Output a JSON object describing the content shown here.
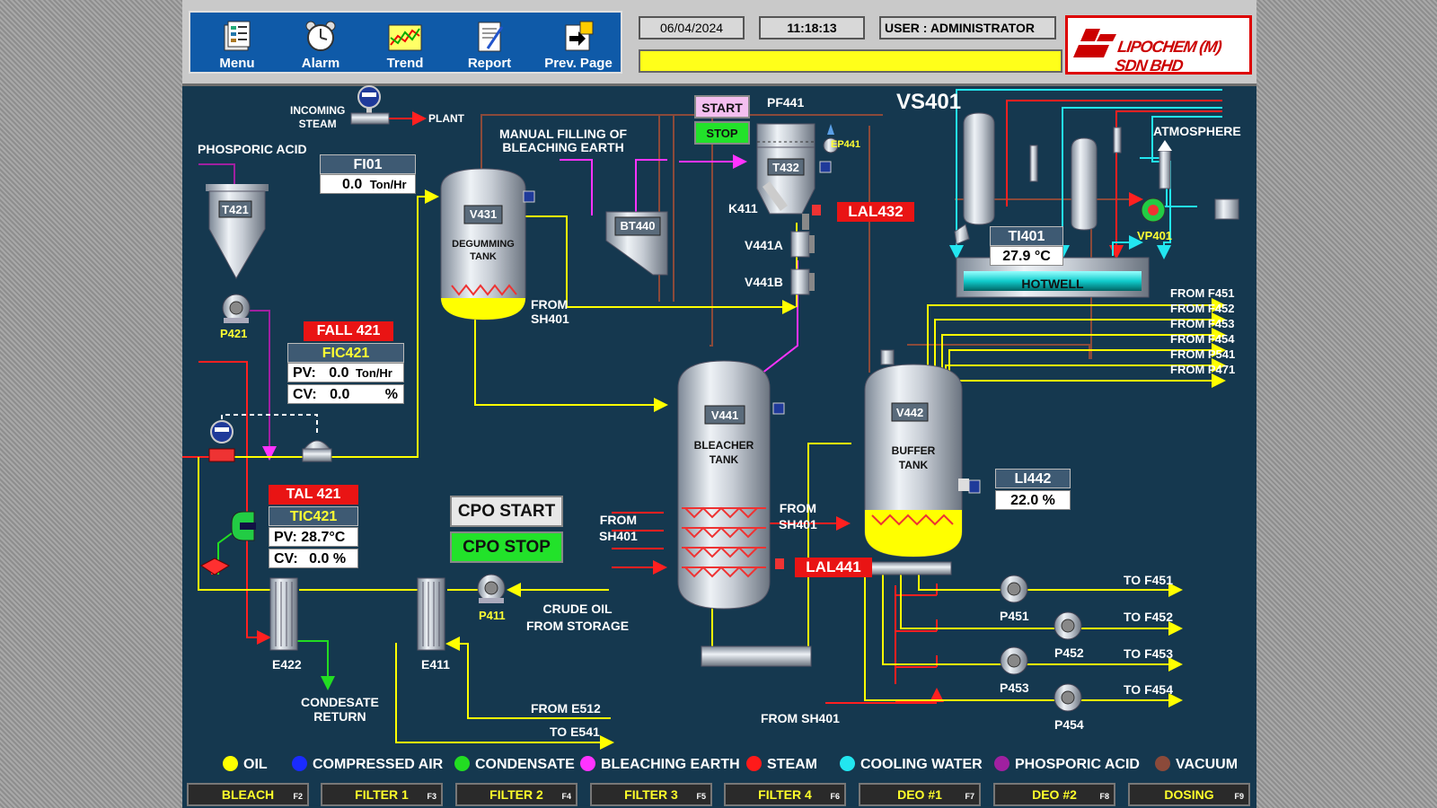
{
  "nav": [
    {
      "label": "Menu",
      "icon": "menu-icon"
    },
    {
      "label": "Alarm",
      "icon": "alarm-clock-icon"
    },
    {
      "label": "Trend",
      "icon": "trend-chart-icon"
    },
    {
      "label": "Report",
      "icon": "report-icon"
    },
    {
      "label": "Prev. Page",
      "icon": "prev-page-icon"
    }
  ],
  "header": {
    "date": "06/04/2024",
    "time": "11:18:13",
    "user": "USER : ADMINISTRATOR",
    "logo_text": "LIPOCHEM (M) SDN BHD"
  },
  "flows": {
    "incoming_steam": "INCOMING\nSTEAM",
    "plant": "PLANT",
    "phosphoric_acid": "PHOSPORIC ACID",
    "manual_filling": "MANUAL FILLING OF\nBLEACHING EARTH",
    "from_sh401_a": "FROM\nSH401",
    "from_sh401_b": "FROM\nSH401",
    "from_sh401_c": "FROM\nSH401",
    "from_sh401_d": "FROM SH401",
    "crude_oil": "CRUDE OIL\nFROM STORAGE",
    "condensate_return": "CONDESATE\nRETURN",
    "from_e512": "FROM E512",
    "to_e541": "TO E541",
    "atmosphere": "ATMOSPHERE",
    "from_list": [
      "FROM F451",
      "FROM F452",
      "FROM F453",
      "FROM F454",
      "FROM P541",
      "FROM P471"
    ],
    "to_list": [
      "TO F451",
      "TO F452",
      "TO F453",
      "TO F454"
    ]
  },
  "equipment": {
    "t421": "T421",
    "p421": "P421",
    "v431": "V431",
    "degumming": "DEGUMMING\nTANK",
    "bt440": "BT440",
    "pf441": "PF441",
    "t432": "T432",
    "ep441": "EP441",
    "k411": "K411",
    "v441a": "V441A",
    "v441b": "V441B",
    "vs401": "VS401",
    "vp401": "VP401",
    "hotwell": "HOTWELL",
    "v441": "V441",
    "bleacher": "BLEACHER\nTANK",
    "v442": "V442",
    "buffer": "BUFFER\nTANK",
    "p411": "P411",
    "e422": "E422",
    "e411": "E411",
    "p451": "P451",
    "p452": "P452",
    "p453": "P453",
    "p454": "P454"
  },
  "instruments": {
    "fi01": {
      "tag": "FI01",
      "value": "0.0",
      "unit": "Ton/Hr"
    },
    "fall421": "FALL  421",
    "fic421": {
      "tag": "FIC421",
      "pv_label": "PV:",
      "pv": "0.0",
      "pv_unit": "Ton/Hr",
      "cv_label": "CV:",
      "cv": "0.0",
      "cv_unit": "%"
    },
    "tal421": "TAL  421",
    "tic421": {
      "tag": "TIC421",
      "pv_label": "PV:",
      "pv": "28.7",
      "pv_unit": "°C",
      "cv_label": "CV:",
      "cv": "0.0",
      "cv_unit": "%"
    },
    "lal432": "LAL432",
    "lal441": "LAL441",
    "ti401": {
      "tag": "TI401",
      "value": "27.9",
      "unit": "°C"
    },
    "li442": {
      "tag": "LI442",
      "value": "22.0",
      "unit": "%"
    }
  },
  "controls": {
    "start": "START",
    "stop": "STOP",
    "cpo_start": "CPO START",
    "cpo_stop": "CPO STOP"
  },
  "legend": [
    {
      "label": "OIL",
      "color": "#ffff00"
    },
    {
      "label": "COMPRESSED AIR",
      "color": "#1a2bff"
    },
    {
      "label": "CONDENSATE",
      "color": "#22dd22"
    },
    {
      "label": "BLEACHING EARTH",
      "color": "#ff33ff"
    },
    {
      "label": "STEAM",
      "color": "#ff1a1a"
    },
    {
      "label": "COOLING WATER",
      "color": "#22e6f0"
    },
    {
      "label": "PHOSPORIC ACID",
      "color": "#a020a0"
    },
    {
      "label": "VACUUM",
      "color": "#8b4a3a"
    }
  ],
  "fkeys": [
    {
      "label": "BLEACH",
      "key": "F2"
    },
    {
      "label": "FILTER 1",
      "key": "F3"
    },
    {
      "label": "FILTER 2",
      "key": "F4"
    },
    {
      "label": "FILTER 3",
      "key": "F5"
    },
    {
      "label": "FILTER 4",
      "key": "F6"
    },
    {
      "label": "DEO #1",
      "key": "F7"
    },
    {
      "label": "DEO #2",
      "key": "F8"
    },
    {
      "label": "DOSING",
      "key": "F9"
    }
  ]
}
